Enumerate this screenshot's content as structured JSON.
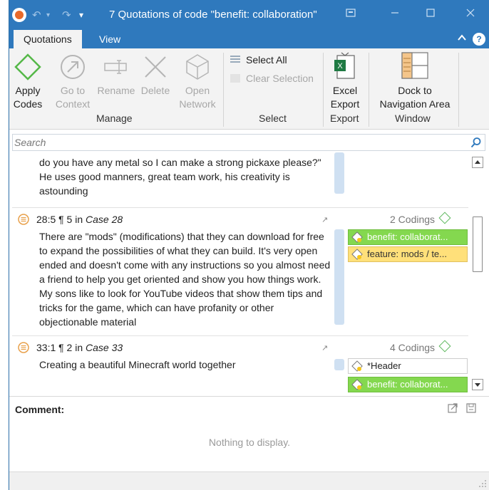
{
  "window": {
    "title": "7 Quotations of code \"benefit: collaboration\"",
    "undo_glyph": "↶",
    "redo_glyph": "↷",
    "qa_dropdown_glyph": "▾",
    "icons": [
      "app-logo-icon",
      "undo-icon",
      "redo-icon",
      "restore-layout-icon",
      "minimize-icon",
      "maximize-icon",
      "close-icon"
    ]
  },
  "tabs": [
    {
      "label": "Quotations",
      "active": true
    },
    {
      "label": "View",
      "active": false
    }
  ],
  "ribbon": {
    "manage": {
      "group_label": "Manage",
      "apply": {
        "line1": "Apply",
        "line2": "Codes"
      },
      "goto": {
        "line1": "Go to",
        "line2": "Context"
      },
      "rename": {
        "line1": "Rename"
      },
      "delete": {
        "line1": "Delete"
      },
      "open_network": {
        "line1": "Open",
        "line2": "Network"
      }
    },
    "select": {
      "group_label": "Select",
      "select_all": "Select All",
      "clear_selection": "Clear Selection"
    },
    "export": {
      "group_label": "Export",
      "excel": {
        "line1": "Excel",
        "line2": "Export"
      }
    },
    "window": {
      "group_label": "Window",
      "dock": {
        "line1": "Dock to",
        "line2": "Navigation Area"
      }
    }
  },
  "search": {
    "placeholder": "Search"
  },
  "quotations": [
    {
      "text": "do you have any metal so I can make a strong pickaxe please?\" He uses good manners, great team work, his creativity is astounding"
    },
    {
      "ref": "28:5 ¶ 5 in ",
      "case": "Case 28",
      "codings": "2 Codings",
      "text": "There are \"mods\" (modifications) that they can download for free to expand the possibilities of what they can build. It's very open ended and doesn't come with any instructions so you almost need a friend to help you get oriented and show you how things work. My sons like to look for YouTube videos that show them tips and tricks for the game, which can have profanity or other objectionable material",
      "codes": [
        {
          "label": "benefit: collaborat...",
          "color": "#84d84f"
        },
        {
          "label": "feature: mods / te...",
          "color": "#ffe07a"
        }
      ]
    },
    {
      "ref": "33:1 ¶ 2 in ",
      "case": "Case 33",
      "codings": "4 Codings",
      "text": "Creating a beautiful Minecraft world together",
      "codes": [
        {
          "label": "*Header",
          "color": "#ffffff"
        },
        {
          "label": "benefit: collaborat...",
          "color": "#84d84f"
        }
      ]
    }
  ],
  "comment": {
    "label": "Comment:",
    "empty": "Nothing to display."
  },
  "colors": {
    "titlebar": "#2f79bd",
    "code_green": "#84d84f",
    "code_yellow": "#ffe07a",
    "accent_green": "#5cb85c"
  }
}
